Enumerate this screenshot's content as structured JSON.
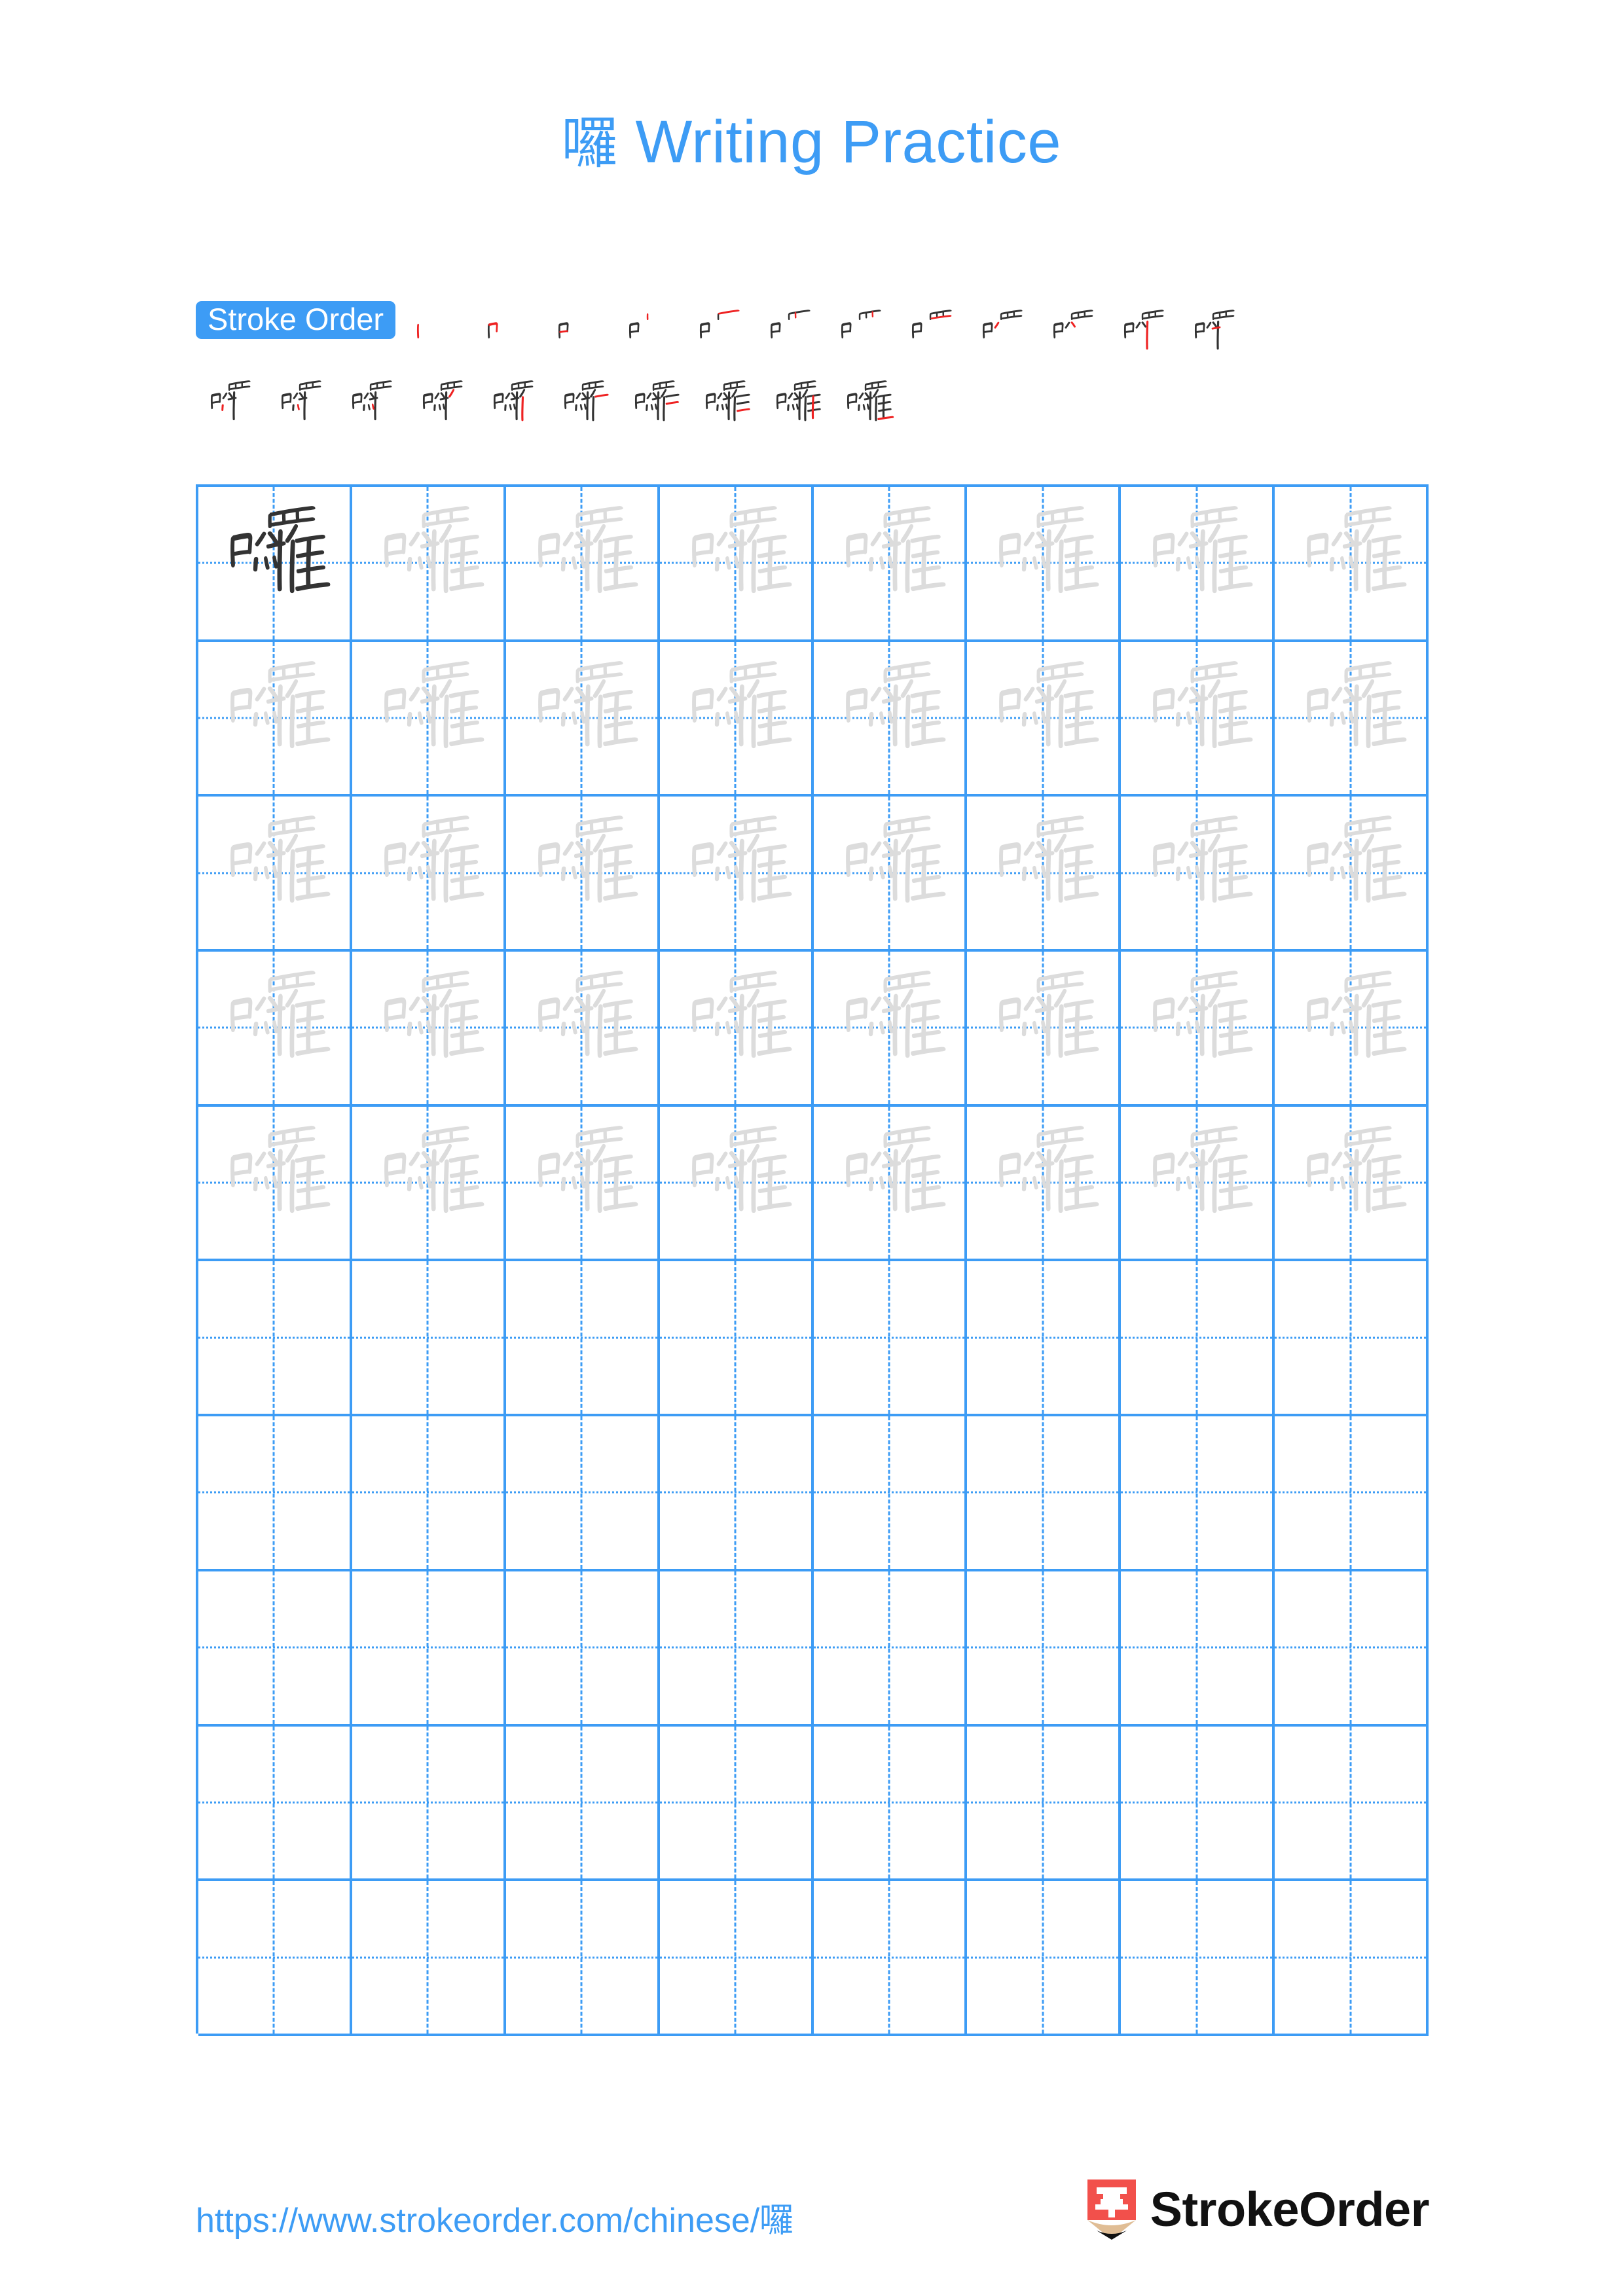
{
  "document": {
    "character": "囉",
    "title_suffix": " Writing Practice",
    "title_full": "囉 Writing Practice",
    "page_background": "#ffffff"
  },
  "colors": {
    "accent_blue": "#3d9cf5",
    "grid_line": "#3d9cf5",
    "stroke_previous": "#333333",
    "stroke_new": "#ee2222",
    "trace_gray": "#dcdcdc",
    "solid_char": "#333333",
    "logo_red": "#f2504b",
    "logo_tan": "#e0bd95",
    "brand_text": "#111111"
  },
  "stroke_order": {
    "badge_label": "Stroke Order",
    "total_strokes": 22,
    "row1_count": 12,
    "row2_count": 10,
    "steps": [
      1,
      2,
      3,
      4,
      5,
      6,
      7,
      8,
      9,
      10,
      11,
      12,
      13,
      14,
      15,
      16,
      17,
      18,
      19,
      20,
      21,
      22
    ]
  },
  "practice_grid": {
    "columns": 8,
    "rows": 10,
    "filled_rows": 5,
    "empty_rows": 5,
    "solid_cell_index": 0,
    "cells_per_row": 8
  },
  "footer": {
    "url": "https://www.strokeorder.com/chinese/囉",
    "url_prefix": "https://www.strokeorder.com/chinese/",
    "url_character": "囉",
    "brand_name": "StrokeOrder",
    "logo_character": "字"
  }
}
